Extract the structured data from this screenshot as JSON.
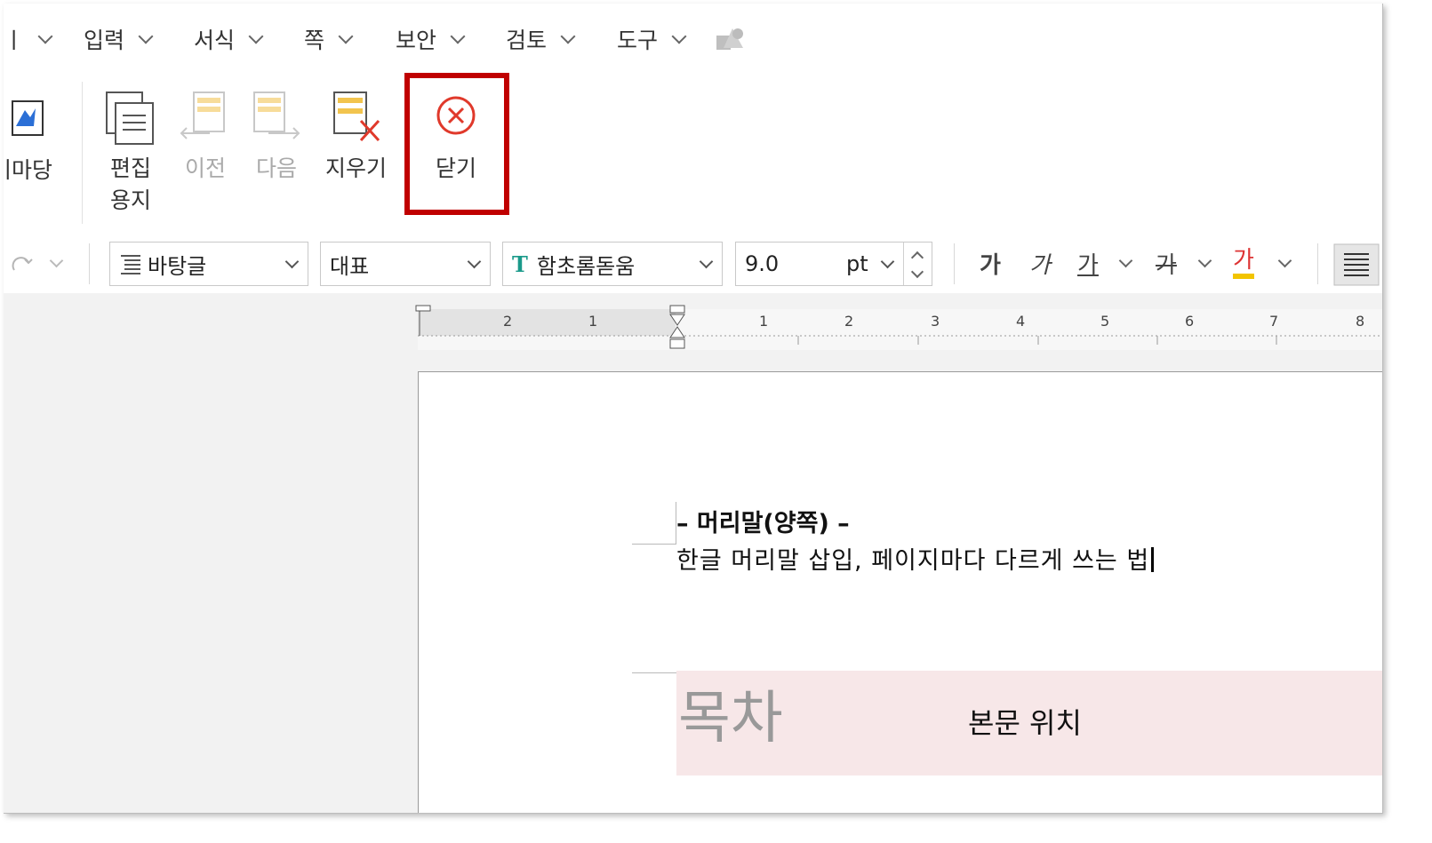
{
  "menu": {
    "items": [
      {
        "label": "ㅣ"
      },
      {
        "label": "입력"
      },
      {
        "label": "서식"
      },
      {
        "label": "쪽"
      },
      {
        "label": "보안"
      },
      {
        "label": "검토"
      },
      {
        "label": "도구"
      }
    ]
  },
  "ribbon": {
    "buttons": [
      {
        "label": "기마당",
        "icon": "watermark-icon",
        "enabled": true
      },
      {
        "label": "편집\n용지",
        "icon": "page-setup-icon",
        "enabled": true
      },
      {
        "label": "이전",
        "icon": "previous-icon",
        "enabled": false
      },
      {
        "label": "다음",
        "icon": "next-icon",
        "enabled": false
      },
      {
        "label": "지우기",
        "icon": "erase-header-icon",
        "enabled": true
      },
      {
        "label": "닫기",
        "icon": "close-circle-icon",
        "enabled": true,
        "highlighted": true
      }
    ],
    "highlight_color": "#c00000"
  },
  "toolbar": {
    "style": "바탕글",
    "language": "대표",
    "font": "함초롬돋움",
    "size": "9.0",
    "unit": "pt",
    "format_buttons": [
      "가",
      "가",
      "가",
      "가",
      "가"
    ]
  },
  "ruler": {
    "left_numbers": [
      "2",
      "1"
    ],
    "right_numbers": [
      "1",
      "2",
      "3",
      "4",
      "5",
      "6",
      "7",
      "8"
    ]
  },
  "document": {
    "header_title": "– 머리말(양쪽) –",
    "header_text": "한글 머리말 삽입, 페이지마다 다르게 쓰는 법",
    "toc_text": "목차",
    "body_label": "본문 위치"
  },
  "colors": {
    "accent_red": "#c00000",
    "body_highlight": "#f7e7e8"
  }
}
